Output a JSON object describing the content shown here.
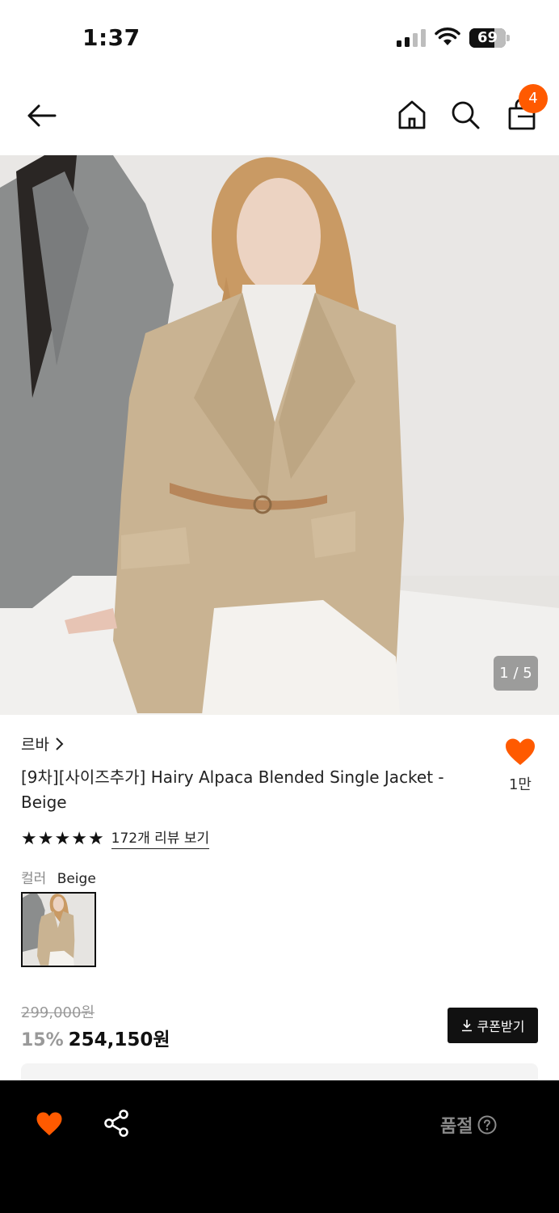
{
  "status_bar": {
    "time": "1:37",
    "battery_level": "69",
    "battery_fraction": 0.69
  },
  "header": {
    "back_icon": "arrow-left-icon",
    "home_icon": "home-icon",
    "search_icon": "search-icon",
    "cart_icon": "shopping-bag-icon",
    "cart_count": "4",
    "badge_color": "#ff5a00"
  },
  "gallery": {
    "counter": "1 / 5"
  },
  "product": {
    "brand": "르바",
    "title": "[9차][사이즈추가] Hairy Alpaca Blended Single Jacket - Beige",
    "like_count": "1만",
    "rating_stars": 5,
    "review_link": "172개 리뷰 보기",
    "color_label": "컬러",
    "color_value": "Beige",
    "original_price": "299,000원",
    "discount_rate": "15%",
    "sale_price": "254,150원",
    "coupon_button": "쿠폰받기"
  },
  "bottom_bar": {
    "wish_icon": "heart-icon",
    "share_icon": "share-icon",
    "status_label": "품절",
    "accent_color": "#ff5a00"
  }
}
